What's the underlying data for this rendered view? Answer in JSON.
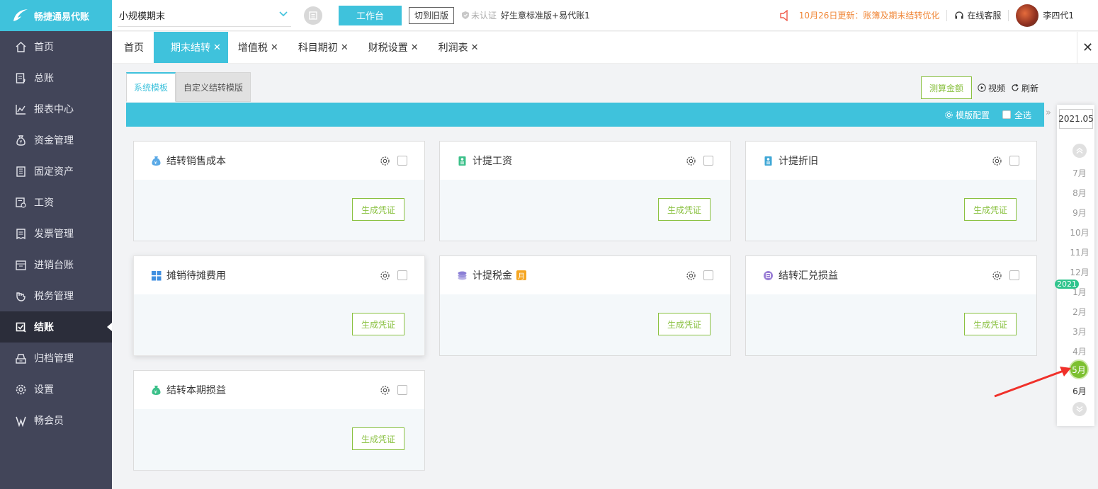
{
  "app": {
    "logo_text": "畅捷通易代账"
  },
  "sidebar": {
    "items": [
      {
        "label": "首页",
        "icon": "home-icon"
      },
      {
        "label": "总账",
        "icon": "ledger-icon"
      },
      {
        "label": "报表中心",
        "icon": "chart-icon"
      },
      {
        "label": "资金管理",
        "icon": "money-bag-icon"
      },
      {
        "label": "固定资产",
        "icon": "building-icon"
      },
      {
        "label": "工资",
        "icon": "salary-icon"
      },
      {
        "label": "发票管理",
        "icon": "invoice-icon"
      },
      {
        "label": "进销台账",
        "icon": "inventory-icon"
      },
      {
        "label": "税务管理",
        "icon": "tax-icon"
      },
      {
        "label": "结账",
        "icon": "checkout-icon",
        "active": true
      },
      {
        "label": "归档管理",
        "icon": "archive-icon"
      },
      {
        "label": "设置",
        "icon": "gear-icon"
      },
      {
        "label": "畅会员",
        "icon": "vip-icon"
      }
    ]
  },
  "topbar": {
    "company": "小规模期末",
    "workbench_label": "工作台",
    "old_version_label": "切到旧版",
    "cert_label": "未认证",
    "plan_label": "好生意标准版+易代账1",
    "notice": "10月26日更新：账簿及期末结转优化",
    "service_label": "在线客服",
    "user_name": "李四代1"
  },
  "tabs": [
    {
      "label": "首页",
      "closable": false
    },
    {
      "label": "期末结转",
      "closable": true,
      "active": true
    },
    {
      "label": "增值税",
      "closable": true
    },
    {
      "label": "科目期初",
      "closable": true
    },
    {
      "label": "财税设置",
      "closable": true
    },
    {
      "label": "利润表",
      "closable": true
    }
  ],
  "main": {
    "subtabs": [
      "系统模板",
      "自定义结转模版"
    ],
    "measure_label": "测算金额",
    "video_label": "视频",
    "refresh_label": "刷新",
    "template_config_label": "模版配置",
    "select_all_label": "全选",
    "generate_label": "生成凭证",
    "month_badge": "月",
    "cards": [
      {
        "title": "结转销售成本",
        "icon": "money-bag-icon",
        "color": "#5aa9e6"
      },
      {
        "title": "计提工资",
        "icon": "id-card-icon",
        "color": "#3cc08a"
      },
      {
        "title": "计提折旧",
        "icon": "id-card-icon",
        "color": "#3fa7d6"
      },
      {
        "title": "摊销待摊费用",
        "icon": "grid-icon",
        "color": "#3f8fe0"
      },
      {
        "title": "计提税金",
        "icon": "coins-icon",
        "color": "#8b7fd6"
      },
      {
        "title": "结转汇兑损益",
        "icon": "exchange-icon",
        "color": "#9b7fd6"
      },
      {
        "title": "结转本期损益",
        "icon": "money-bag-icon",
        "color": "#3cc08a"
      }
    ]
  },
  "month_picker": {
    "year_value": "2021.05",
    "year_tag": "2021",
    "months": [
      "7月",
      "8月",
      "9月",
      "10月",
      "11月",
      "12月",
      "1月",
      "2月",
      "3月",
      "4月",
      "5月",
      "6月"
    ],
    "selected": "5月"
  },
  "colors": {
    "accent": "#3fc2dc",
    "green": "#8ac141",
    "sidebar": "#424559",
    "notice": "#f0883a"
  }
}
